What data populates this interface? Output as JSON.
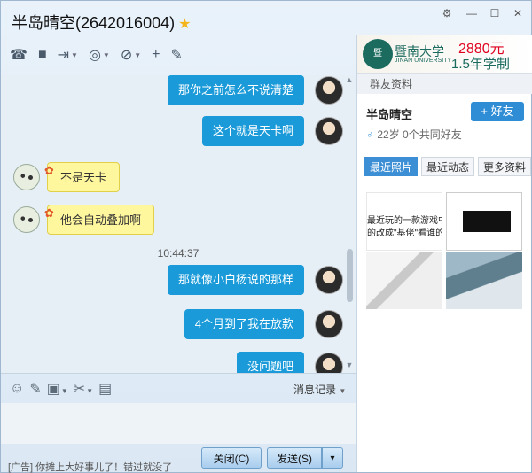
{
  "window": {
    "title": "半岛晴空(2642016004)",
    "controls": [
      "⚙",
      "—",
      "☐",
      "✕"
    ]
  },
  "toolbar": {
    "items": [
      {
        "name": "phone-icon",
        "glyph": "☎",
        "caret": false
      },
      {
        "name": "video-icon",
        "glyph": "■",
        "caret": false
      },
      {
        "name": "file-transfer-icon",
        "glyph": "⇥",
        "caret": true
      },
      {
        "name": "app-icon",
        "glyph": "◎",
        "caret": true
      },
      {
        "name": "block-user-icon",
        "glyph": "⊘",
        "caret": true
      },
      {
        "name": "add-user-icon",
        "glyph": "+",
        "caret": false
      },
      {
        "name": "comment-icon",
        "glyph": "✎",
        "caret": false
      }
    ]
  },
  "chat": {
    "messages": [
      {
        "side": "right",
        "text": "那你之前怎么不说清楚"
      },
      {
        "side": "right",
        "text": "这个就是天卡啊"
      },
      {
        "side": "left",
        "text": "不是天卡"
      },
      {
        "side": "left",
        "text": "他会自动叠加啊"
      },
      {
        "side": "right",
        "text": "那就像小白杨说的那样"
      },
      {
        "side": "right",
        "text": "4个月到了我在放款"
      },
      {
        "side": "right",
        "text": "没问题吧"
      }
    ],
    "timestamp": "10:44:37"
  },
  "input": {
    "history_label": "消息记录",
    "ad_text": "[广告] 你摊上大好事儿了！错过就没了",
    "close_button": "关闭(C)",
    "send_button": "发送(S)",
    "send_caret": "▾"
  },
  "side_panel": {
    "ad": {
      "school_name": "暨南大学",
      "school_sub": "JINAN UNIVERSITY",
      "price": "2880元",
      "plan": "1.5年学制"
    },
    "header": "群友资料",
    "user_name": "半岛晴空",
    "add_friend_label": "好友",
    "user_info": "22岁  0个共同好友",
    "tabs": [
      "最近照片",
      "最近动态",
      "更多资料"
    ],
    "photo1_lines": [
      "最近玩的一款游戏中",
      "的改成\"基佬\"看谁的"
    ]
  },
  "colors": {
    "blue_bubble": "#1a9ad8",
    "yellow_bubble": "#fff79e",
    "accent": "#2f8dd6"
  }
}
